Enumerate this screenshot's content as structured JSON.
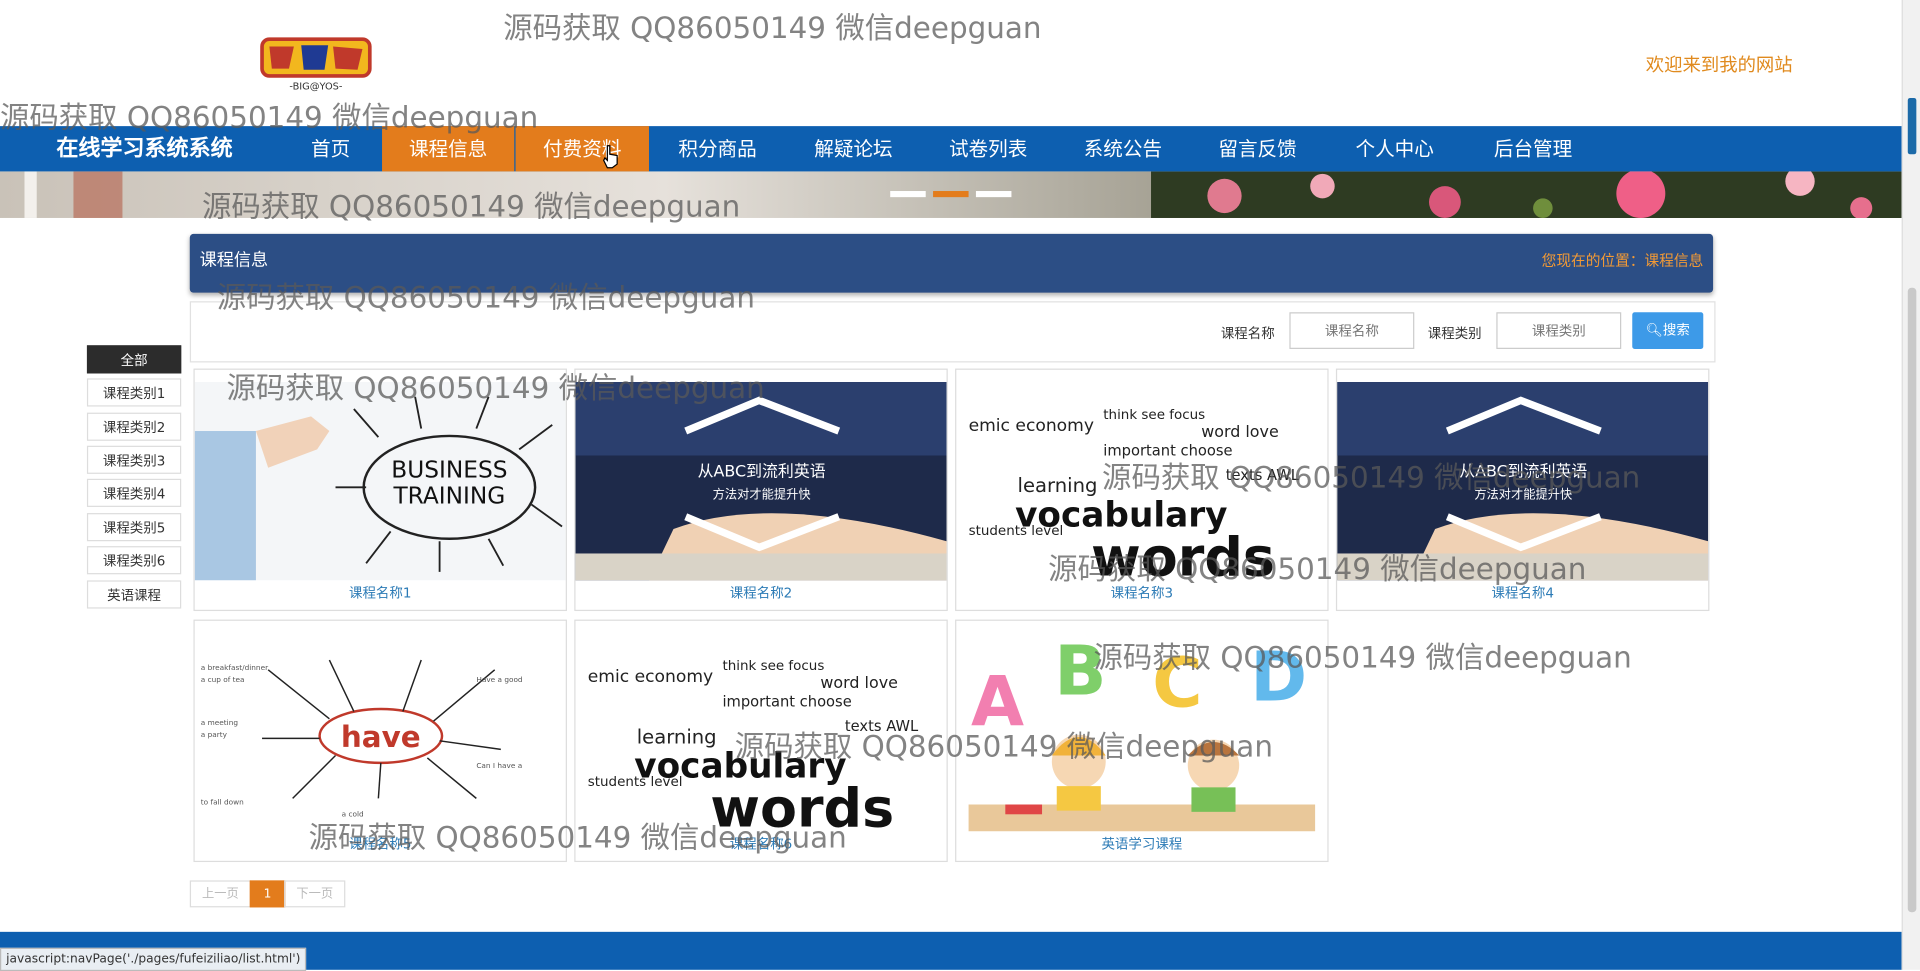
{
  "watermark": "源码获取 QQ86050149 微信deepguan",
  "header": {
    "welcome": "欢迎来到我的网站"
  },
  "nav": {
    "brand": "在线学习系统系统",
    "items": [
      "首页",
      "课程信息",
      "付费资料",
      "积分商品",
      "解疑论坛",
      "试卷列表",
      "系统公告",
      "留言反馈",
      "个人中心",
      "后台管理"
    ],
    "active": "课程信息",
    "hovered": "付费资料"
  },
  "page": {
    "title": "课程信息",
    "location": "您现在的位置：课程信息"
  },
  "search": {
    "name_label": "课程名称",
    "name_placeholder": "课程名称",
    "type_label": "课程类别",
    "type_placeholder": "课程类别",
    "button": "搜索"
  },
  "categories": {
    "items": [
      "全部",
      "课程类别1",
      "课程类别2",
      "课程类别3",
      "课程类别4",
      "课程类别5",
      "课程类别6",
      "英语课程"
    ],
    "active": "全部"
  },
  "courses": [
    {
      "name": "课程名称1",
      "image": "business-training",
      "image_text": [
        "BUSINESS",
        "TRAINING"
      ]
    },
    {
      "name": "课程名称2",
      "image": "english-banner",
      "image_text": [
        "从ABC到流利英语",
        "方法对才能提升快"
      ]
    },
    {
      "name": "课程名称3",
      "image": "words-cloud",
      "image_text": [
        "vocabulary",
        "words"
      ]
    },
    {
      "name": "课程名称4",
      "image": "english-banner",
      "image_text": [
        "从ABC到流利英语",
        "方法对才能提升快"
      ]
    },
    {
      "name": "课程名称5",
      "image": "have-mindmap",
      "image_text": [
        "have"
      ]
    },
    {
      "name": "课程名称6",
      "image": "words-cloud",
      "image_text": [
        "vocabulary",
        "words"
      ]
    },
    {
      "name": "英语学习课程",
      "image": "abcd-kids",
      "image_text": [
        "A",
        "B",
        "C",
        "D"
      ]
    }
  ],
  "pagination": {
    "prev": "上一页",
    "current": "1",
    "next": "下一页"
  },
  "status_bar": "javascript:navPage('./pages/fufeiziliao/list.html')",
  "colors": {
    "nav_bg": "#0d5fb0",
    "active_orange": "#e37c1c",
    "header_blue": "#2c4e85",
    "search_btn": "#3d9ae8"
  }
}
